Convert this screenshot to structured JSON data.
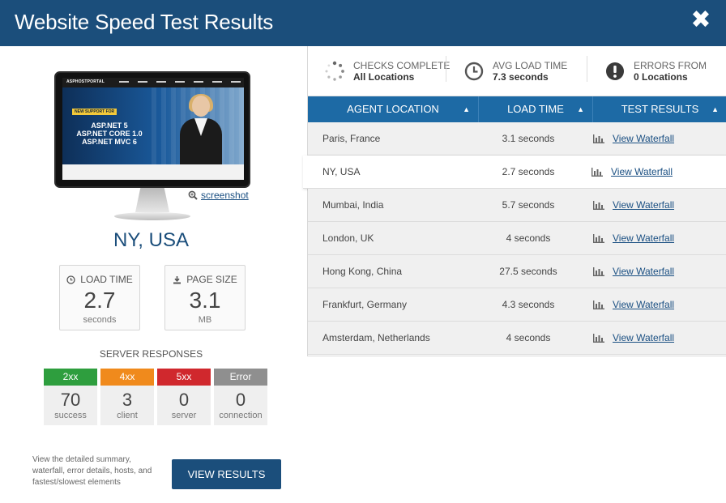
{
  "header": {
    "title": "Website Speed Test Results",
    "close_glyph": "✖"
  },
  "preview": {
    "site_logo": "ASPHOSTPORTAL",
    "hero_tag": "NEW SUPPORT FOR",
    "hero_lines": [
      "ASP.NET 5",
      "ASP.NET CORE 1.0",
      "ASP.NET MVC 6"
    ],
    "screenshot_link": "screenshot"
  },
  "location": "NY, USA",
  "stats": {
    "load_time": {
      "label": "LOAD TIME",
      "value": "2.7",
      "unit": "seconds"
    },
    "page_size": {
      "label": "PAGE SIZE",
      "value": "3.1",
      "unit": "MB"
    }
  },
  "server_responses": {
    "title": "SERVER RESPONSES",
    "items": [
      {
        "code": "2xx",
        "count": "70",
        "label": "success",
        "color": "#2e9e3e"
      },
      {
        "code": "4xx",
        "count": "3",
        "label": "client",
        "color": "#f08a1c"
      },
      {
        "code": "5xx",
        "count": "0",
        "label": "server",
        "color": "#d0282d"
      },
      {
        "code": "Error",
        "count": "0",
        "label": "connection",
        "color": "#8f8f8f"
      }
    ]
  },
  "cta": {
    "text": "View the detailed summary, waterfall, error details, hosts, and fastest/slowest elements",
    "button": "VIEW RESULTS"
  },
  "summary": {
    "checks": {
      "label": "CHECKS COMPLETE",
      "value": "All Locations"
    },
    "avg": {
      "label": "AVG LOAD TIME",
      "value": "7.3 seconds"
    },
    "errors": {
      "label": "ERRORS FROM",
      "value": "0 Locations"
    }
  },
  "table": {
    "columns": [
      "AGENT LOCATION",
      "LOAD TIME",
      "TEST RESULTS"
    ],
    "link_label": "View Waterfall",
    "rows": [
      {
        "location": "Paris, France",
        "time": "3.1 seconds"
      },
      {
        "location": "NY, USA",
        "time": "2.7 seconds"
      },
      {
        "location": "Mumbai, India",
        "time": "5.7 seconds"
      },
      {
        "location": "London, UK",
        "time": "4 seconds"
      },
      {
        "location": "Hong Kong, China",
        "time": "27.5 seconds"
      },
      {
        "location": "Frankfurt, Germany",
        "time": "4.3 seconds"
      },
      {
        "location": "Amsterdam, Netherlands",
        "time": "4 seconds"
      }
    ]
  }
}
